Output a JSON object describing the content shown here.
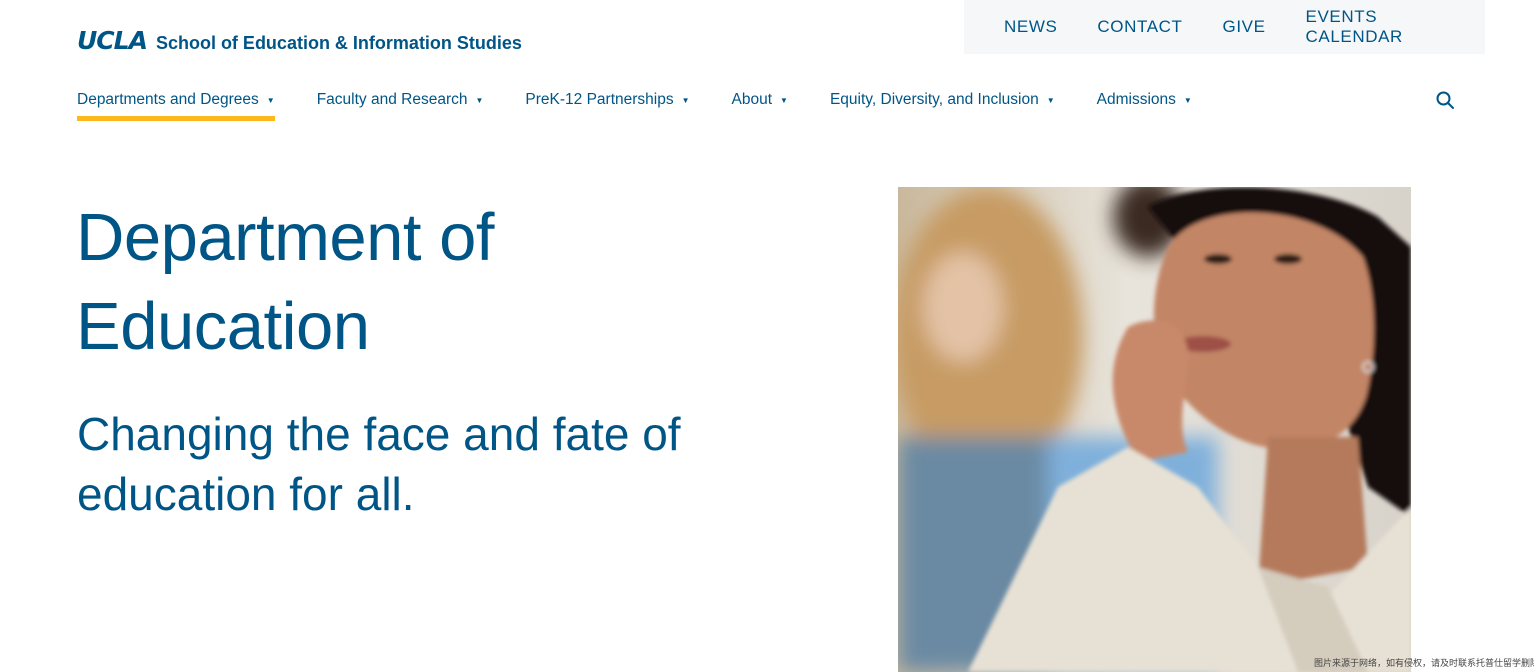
{
  "logo": {
    "ucla": "UCLA",
    "school": "School of Education & Information Studies"
  },
  "utility_nav": [
    "NEWS",
    "CONTACT",
    "GIVE",
    "EVENTS CALENDAR"
  ],
  "main_nav": [
    "Departments and Degrees",
    "Faculty and Research",
    "PreK-12 Partnerships",
    "About",
    "Equity, Diversity, and Inclusion",
    "Admissions"
  ],
  "nav_caret": "▼",
  "hero": {
    "title_line1": "Department of",
    "title_line2": "Education",
    "subtitle_line1": "Changing the face and fate of",
    "subtitle_line2": "education for all."
  },
  "watermark": "图片来源于网络，如有侵权，请及时联系托普仕留学删除",
  "colors": {
    "brand_blue": "#005587",
    "accent_gold": "#ffb81c",
    "utility_bg": "#f5f7f9"
  }
}
